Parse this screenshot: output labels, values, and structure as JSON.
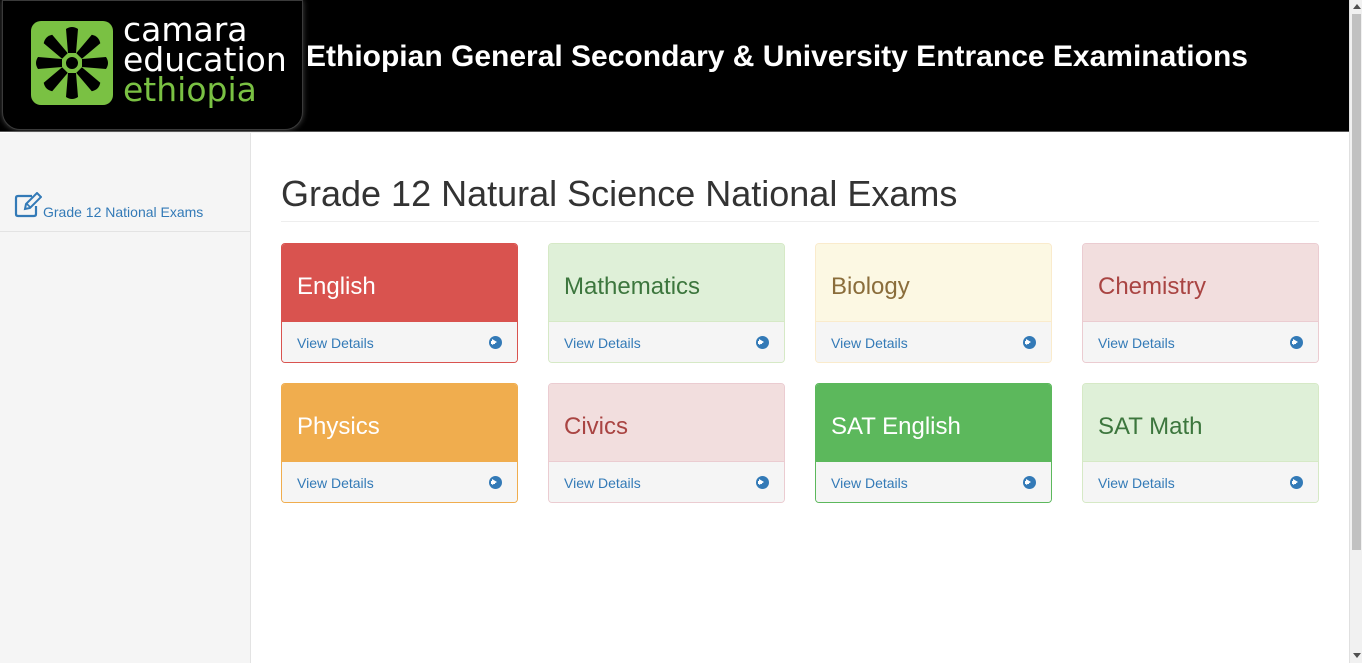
{
  "header": {
    "logo": {
      "line1": "camara",
      "line2": "education",
      "line3": "ethiopia",
      "icon": "camara-flower-logo-icon"
    },
    "site_title": "Ethiopian General Secondary & University Entrance Examinations"
  },
  "sidebar": {
    "items": [
      {
        "label": "Grade 12 National Exams",
        "icon": "edit-icon"
      }
    ]
  },
  "main": {
    "page_title": "Grade 12 Natural Science National Exams",
    "cards": [
      {
        "title": "English",
        "link": "View Details",
        "theme": "danger-solid",
        "color": "#d9534f"
      },
      {
        "title": "Mathematics",
        "link": "View Details",
        "theme": "success-light",
        "color": "#dff0d8"
      },
      {
        "title": "Biology",
        "link": "View Details",
        "theme": "warning-light",
        "color": "#fcf8e3"
      },
      {
        "title": "Chemistry",
        "link": "View Details",
        "theme": "danger-light",
        "color": "#f2dede"
      },
      {
        "title": "Physics",
        "link": "View Details",
        "theme": "warning-solid",
        "color": "#f0ad4e"
      },
      {
        "title": "Civics",
        "link": "View Details",
        "theme": "danger-light",
        "color": "#f2dede"
      },
      {
        "title": "SAT English",
        "link": "View Details",
        "theme": "success-solid",
        "color": "#5cb85c"
      },
      {
        "title": "SAT Math",
        "link": "View Details",
        "theme": "success-light",
        "color": "#dff0d8"
      }
    ],
    "link_icon": "circle-arrow-right-icon"
  },
  "colors": {
    "link": "#337ab7",
    "logo_green": "#7ac143",
    "header_bg": "#000000"
  }
}
